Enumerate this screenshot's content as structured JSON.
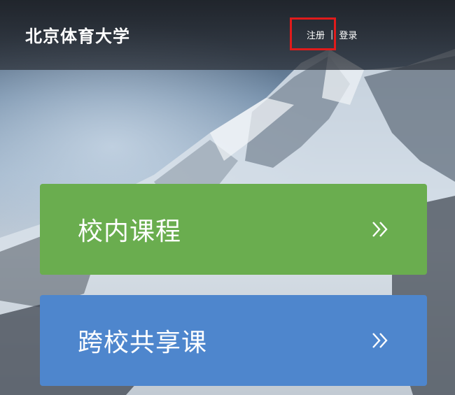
{
  "header": {
    "brand": "北京体育大学",
    "register_label": "注册",
    "separator": "|",
    "login_label": "登录"
  },
  "cards": [
    {
      "label": "校内课程",
      "color": "#6aad4f",
      "icon": "double-chevron-right-icon"
    },
    {
      "label": "跨校共享课",
      "color": "#4e86cd",
      "icon": "double-chevron-right-icon"
    }
  ],
  "annotation": {
    "highlight_color": "#e01b1b"
  }
}
